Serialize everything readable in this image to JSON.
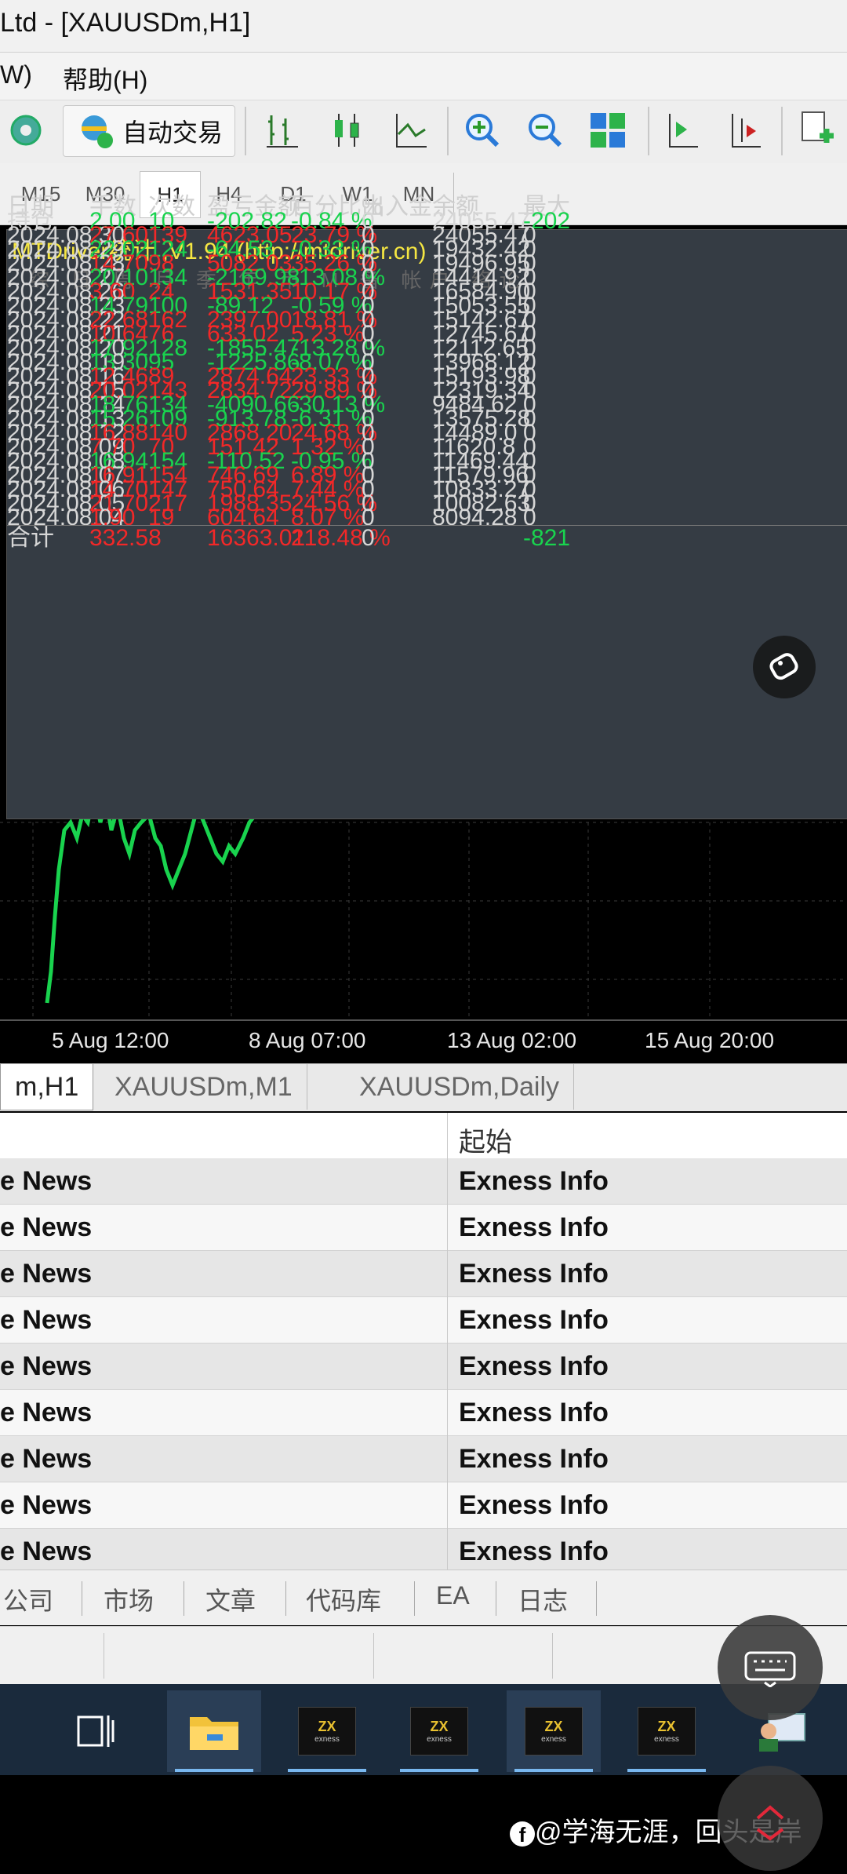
{
  "window": {
    "title": "Ltd - [XAUUSDm,H1]"
  },
  "menu": {
    "items": [
      "W)",
      "帮助(H)"
    ]
  },
  "toolbar": {
    "autotrade_label": "自动交易"
  },
  "timeframes": [
    "M15",
    "M30",
    "H1",
    "H4",
    "D1",
    "W1",
    "MN"
  ],
  "active_timeframe": "H1",
  "chart": {
    "time_labels": [
      "5 Aug 12:00",
      "8 Aug 07:00",
      "13 Aug 02:00",
      "15 Aug 20:00"
    ],
    "right_value": "-821"
  },
  "stats_panel": {
    "title": "MTDriver统计 ,V1.94 (http://mtdriver.cn)",
    "tabs": "综 日 周 月 季 年 币 M 备 帐户 络论",
    "headers": [
      "日期",
      "手数",
      "次数",
      "盈亏金额",
      "百分比%",
      "出入金",
      "余额",
      "最大"
    ],
    "rows": [
      {
        "date": "持仓",
        "lots": "2.00",
        "count": "10",
        "pnl": "-202.82",
        "pct": "-0.84 %",
        "io": "0",
        "balance": "24055.47",
        "max": "-202",
        "up": false
      },
      {
        "date": "2024.08.30",
        "lots": "27.60",
        "count": "139",
        "pnl": "4623.05",
        "pct": "23.79 %",
        "io": "0",
        "balance": "24055.47",
        "max": "0",
        "up": true
      },
      {
        "date": "2024.08.29",
        "lots": "22.02",
        "count": "124",
        "pnl": "-64.53",
        "pct": "-0.33 %",
        "io": "0",
        "balance": "19432.42",
        "max": "0",
        "up": false
      },
      {
        "date": "2024.08.28",
        "lots": "14.70",
        "count": "98",
        "pnl": "5082.03",
        "pct": "35.26 %",
        "io": "0",
        "balance": "19496.95",
        "max": "0",
        "up": true
      },
      {
        "date": "2024.08.27",
        "lots": "20.10",
        "count": "134",
        "pnl": "-2169.98",
        "pct": "-13.08 %",
        "io": "0",
        "balance": "14414.92",
        "max": "0",
        "up": false
      },
      {
        "date": "2024.08.26",
        "lots": "3.60",
        "count": "24",
        "pnl": "1531.35",
        "pct": "10.17 %",
        "io": "0",
        "balance": "16584.90",
        "max": "0",
        "up": true
      },
      {
        "date": "2024.08.23",
        "lots": "14.79",
        "count": "100",
        "pnl": "-89.12",
        "pct": "-0.59 %",
        "io": "0",
        "balance": "15053.55",
        "max": "0",
        "up": false
      },
      {
        "date": "2024.08.22",
        "lots": "22.68",
        "count": "162",
        "pnl": "2397.00",
        "pct": "18.81 %",
        "io": "0",
        "balance": "15142.67",
        "max": "0",
        "up": true
      },
      {
        "date": "2024.08.21",
        "lots": "10.64",
        "count": "76",
        "pnl": "633.02",
        "pct": "5.23 %",
        "io": "0",
        "balance": "12745.67",
        "max": "0",
        "up": true
      },
      {
        "date": "2024.08.20",
        "lots": "17.92",
        "count": "128",
        "pnl": "-1855.47",
        "pct": "-13.28 %",
        "io": "0",
        "balance": "12112.65",
        "max": "0",
        "up": false
      },
      {
        "date": "2024.08.19",
        "lots": "13.30",
        "count": "95",
        "pnl": "-1225.86",
        "pct": "-8.07 %",
        "io": "0",
        "balance": "13968.12",
        "max": "0",
        "up": false
      },
      {
        "date": "2024.08.16",
        "lots": "12.46",
        "count": "89",
        "pnl": "2874.64",
        "pct": "23.33 %",
        "io": "0",
        "balance": "15193.98",
        "max": "0",
        "up": true
      },
      {
        "date": "2024.08.15",
        "lots": "20.02",
        "count": "143",
        "pnl": "2834.72",
        "pct": "29.89 %",
        "io": "0",
        "balance": "12319.34",
        "max": "0",
        "up": true
      },
      {
        "date": "2024.08.14",
        "lots": "18.76",
        "count": "134",
        "pnl": "-4090.66",
        "pct": "-30.13 %",
        "io": "0",
        "balance": "9484.62",
        "max": "0",
        "up": false
      },
      {
        "date": "2024.08.13",
        "lots": "15.26",
        "count": "109",
        "pnl": "-913.78",
        "pct": "-6.31 %",
        "io": "0",
        "balance": "13575.28",
        "max": "0",
        "up": false
      },
      {
        "date": "2024.08.12",
        "lots": "16.88",
        "count": "140",
        "pnl": "2868.20",
        "pct": "24.68 %",
        "io": "0",
        "balance": "14489.0",
        "max": "0",
        "up": true
      },
      {
        "date": "2024.08.09",
        "lots": "7.70",
        "count": "70",
        "pnl": "151.42",
        "pct": "1.32 %",
        "io": "0",
        "balance": "11620.8",
        "max": "0",
        "up": true
      },
      {
        "date": "2024.08.08",
        "lots": "16.94",
        "count": "154",
        "pnl": "-110.52",
        "pct": "-0.95 %",
        "io": "0",
        "balance": "11469.44",
        "max": "0",
        "up": false
      },
      {
        "date": "2024.08.07",
        "lots": "16.91",
        "count": "154",
        "pnl": "746.69",
        "pct": "6.89 %",
        "io": "0",
        "balance": "11579.96",
        "max": "0",
        "up": true
      },
      {
        "date": "2024.08.06",
        "lots": "14.70",
        "count": "147",
        "pnl": "750.64",
        "pct": "7.44 %",
        "io": "0",
        "balance": "10833.27",
        "max": "0",
        "up": true
      },
      {
        "date": "2024.08.05",
        "lots": "21.70",
        "count": "217",
        "pnl": "1988.35",
        "pct": "24.56 %",
        "io": "0",
        "balance": "10082.63",
        "max": "0",
        "up": true
      },
      {
        "date": "2024.08.04",
        "lots": "1.90",
        "count": "19",
        "pnl": "604.64",
        "pct": "8.07 %",
        "io": "0",
        "balance": "8094.28",
        "max": "0",
        "up": true
      }
    ],
    "total": {
      "label": "合计",
      "lots": "332.58",
      "pnl": "16363.01",
      "pct": "218.48 %",
      "io": "0"
    }
  },
  "chart_tabs": [
    "m,H1",
    "XAUUSDm,M1",
    "XAUUSDm,Daily"
  ],
  "news": {
    "header_origin": "起始",
    "rows": [
      {
        "title": "e News",
        "origin": "Exness Info"
      },
      {
        "title": "e News",
        "origin": "Exness Info"
      },
      {
        "title": "e News",
        "origin": "Exness Info"
      },
      {
        "title": "e News",
        "origin": "Exness Info"
      },
      {
        "title": "e News",
        "origin": "Exness Info"
      },
      {
        "title": "e News",
        "origin": "Exness Info"
      },
      {
        "title": "e News",
        "origin": "Exness Info"
      },
      {
        "title": "e News",
        "origin": "Exness Info"
      },
      {
        "title": "e News",
        "origin": "Exness Info"
      }
    ]
  },
  "terminal_tabs": [
    "公司",
    "市场",
    "文章",
    "代码库",
    "EA",
    "日志"
  ],
  "taskbar": {
    "exness_label": "exness"
  },
  "watermark": "@学海无涯，回头是岸",
  "colors": {
    "profit": "#19d34e",
    "loss": "#f22828",
    "panel_bg": "#353c44",
    "panel_title": "#f5e642",
    "taskbar": "#1a2a3c"
  }
}
